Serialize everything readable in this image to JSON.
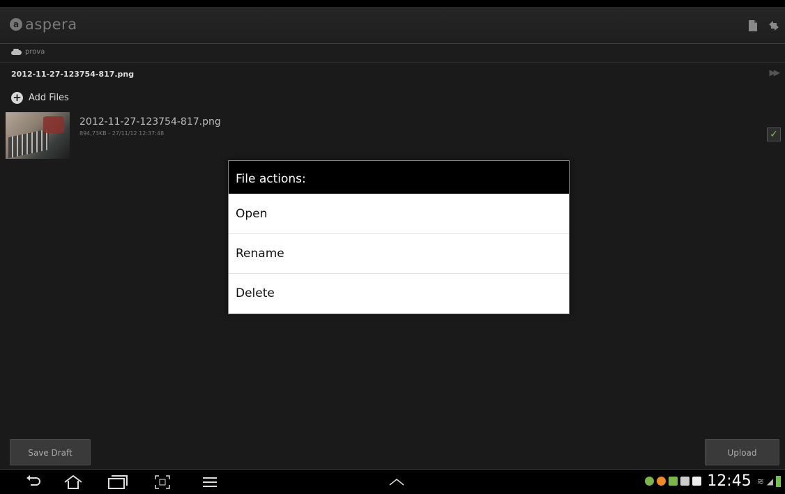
{
  "app": {
    "brand": "aspera",
    "breadcrumb": "prova"
  },
  "transfer": {
    "title": "2012-11-27-123754-817.png",
    "add_files_label": "Add Files"
  },
  "files": [
    {
      "name": "2012-11-27-123754-817.png",
      "meta": "894,73KB - 27/11/12 12:37:48",
      "checked": true
    }
  ],
  "dialog": {
    "title": "File actions:",
    "items": [
      {
        "label": "Open"
      },
      {
        "label": "Rename"
      },
      {
        "label": "Delete"
      }
    ]
  },
  "buttons": {
    "save_draft": "Save Draft",
    "upload": "Upload"
  },
  "status_bar": {
    "time": "12:45"
  },
  "colors": {
    "background": "#1a1a1a",
    "dialog_title_bg": "#000000",
    "dialog_bg": "#ffffff",
    "check_green": "#7fbf3a",
    "battery_green": "#6cc644"
  }
}
